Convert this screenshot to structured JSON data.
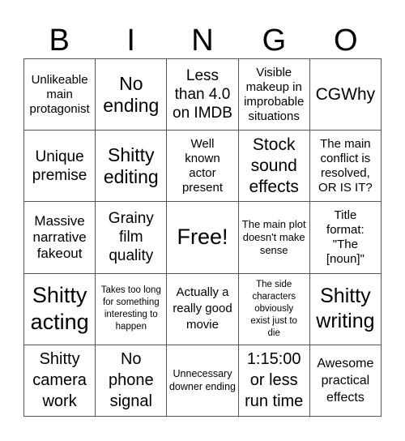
{
  "header": {
    "letters": [
      "B",
      "I",
      "N",
      "G",
      "O"
    ]
  },
  "cells": [
    "Unlikeable main protagonist",
    "No ending",
    "Less than 4.0 on IMDB",
    "Visible makeup in improbable situations",
    "CGWhy",
    "Unique premise",
    "Shitty editing",
    "Well known actor present",
    "Stock sound effects",
    "The main conflict is resolved, OR IS IT?",
    "Massive narrative fakeout",
    "Grainy film quality",
    "Free!",
    "The main plot doesn't make sense",
    "Title format: \"The [noun]\"",
    "Shitty acting",
    "Takes too long for something interesting to happen",
    "Actually a really good movie",
    "The side characters obviously exist just to die",
    "Shitty writing",
    "Shitty camera work",
    "No phone signal",
    "Unnecessary downer ending",
    "1:15:00 or less run time",
    "Awesome practical effects"
  ]
}
